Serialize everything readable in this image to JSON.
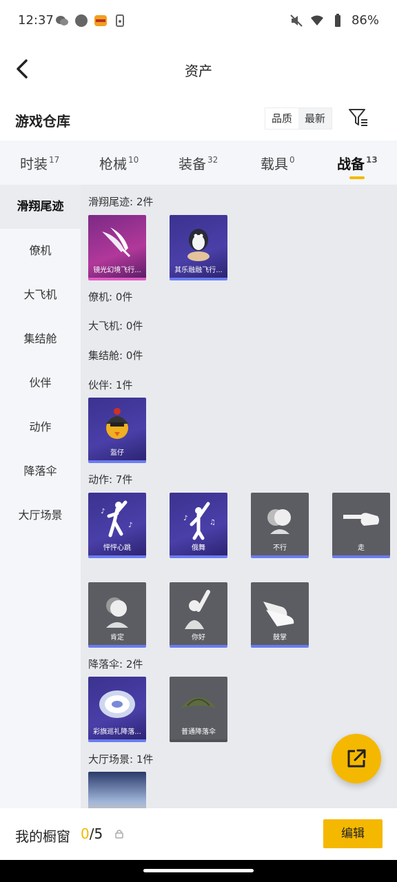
{
  "status_bar": {
    "time": "12:37",
    "battery": "86%"
  },
  "nav": {
    "title": "资产"
  },
  "warehouse": {
    "title": "游戏仓库",
    "sort_options": [
      "品质",
      "最新"
    ]
  },
  "tabs": [
    {
      "label": "时装",
      "count": "17"
    },
    {
      "label": "枪械",
      "count": "10"
    },
    {
      "label": "装备",
      "count": "32"
    },
    {
      "label": "载具",
      "count": "0"
    },
    {
      "label": "战备",
      "count": "13"
    }
  ],
  "active_tab": "战备",
  "sidebar": [
    "滑翔尾迹",
    "僚机",
    "大飞机",
    "集结舱",
    "伙伴",
    "动作",
    "降落伞",
    "大厅场景"
  ],
  "sections": {
    "glide": {
      "title": "滑翔尾迹: 2件",
      "items": [
        "镜光幻境飞行...",
        "其乐融融飞行..."
      ]
    },
    "wingman": {
      "title": "僚机: 0件"
    },
    "bigplane": {
      "title": "大飞机: 0件"
    },
    "pod": {
      "title": "集结舱: 0件"
    },
    "partner": {
      "title": "伙伴: 1件",
      "items": [
        "盔仔"
      ]
    },
    "action": {
      "title": "动作: 7件",
      "items": [
        "怦怦心跳",
        "俄舞",
        "不行",
        "走",
        "肯定",
        "你好",
        "鼓掌"
      ]
    },
    "parachute": {
      "title": "降落伞: 2件",
      "items": [
        "彩旗巡礼降落...",
        "普通降落伞"
      ]
    },
    "lobby": {
      "title": "大厅场景: 1件"
    }
  },
  "bottom": {
    "label": "我的橱窗",
    "count_current": "0",
    "count_total": "/5",
    "edit_label": "编辑"
  },
  "colors": {
    "accent": "#f5b800",
    "purple_card": "#3b3290",
    "gray_card": "#5b5d63"
  }
}
